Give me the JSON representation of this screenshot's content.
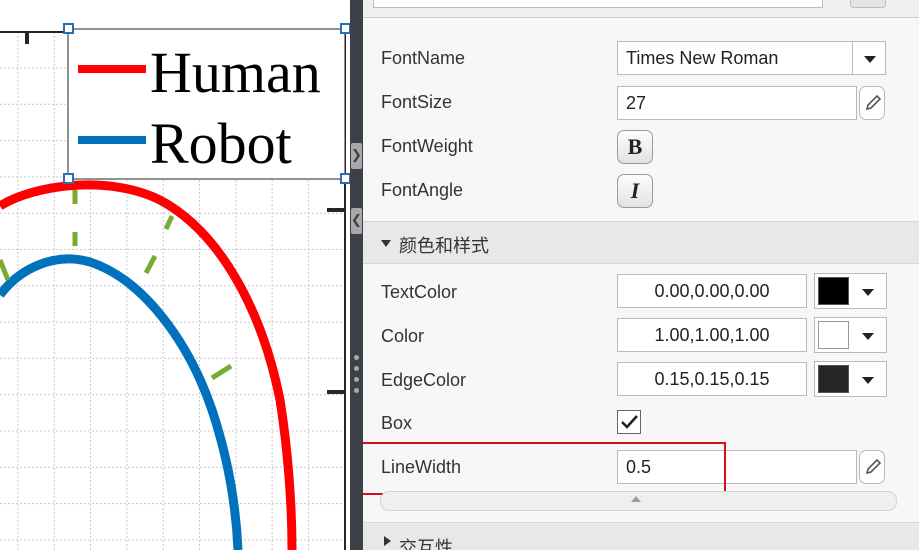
{
  "figure": {
    "legend": {
      "entries": [
        {
          "label": "Human",
          "color": "#ff0000"
        },
        {
          "label": "Robot",
          "color": "#0072bd"
        }
      ]
    },
    "colors": {
      "human": "#ff0000",
      "robot": "#0072bd",
      "tick_marks": "#77ac30",
      "grid": "#c8c8c8"
    }
  },
  "inspector": {
    "font_section": {
      "fontname_label": "FontName",
      "fontname_value": "Times New Roman",
      "fontsize_label": "FontSize",
      "fontsize_value": "27",
      "fontweight_label": "FontWeight",
      "fontweight_button": "B",
      "fontangle_label": "FontAngle",
      "fontangle_button": "I"
    },
    "color_style_section": {
      "title": "颜色和样式",
      "textcolor_label": "TextColor",
      "textcolor_value": "0.00,0.00,0.00",
      "textcolor_swatch": "#000000",
      "color_label": "Color",
      "color_value": "1.00,1.00,1.00",
      "color_swatch": "#ffffff",
      "edgecolor_label": "EdgeColor",
      "edgecolor_value": "0.15,0.15,0.15",
      "edgecolor_swatch": "#262626",
      "box_label": "Box",
      "box_checked": true,
      "linewidth_label": "LineWidth",
      "linewidth_value": "0.5"
    },
    "interactivity_section": {
      "title": "交互性"
    },
    "highlight_color": "#d1121b"
  }
}
